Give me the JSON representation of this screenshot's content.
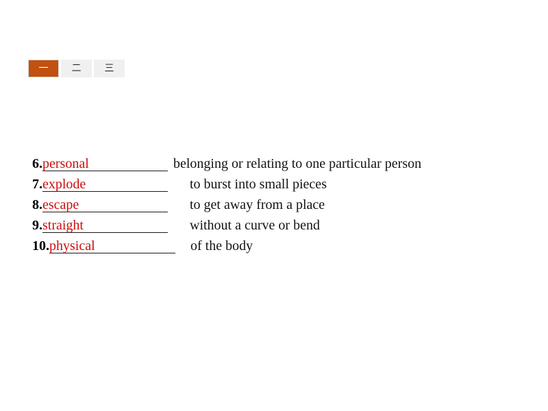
{
  "slide": {
    "background_color": "#ffffff"
  },
  "tabs": {
    "active_index": 0,
    "items": [
      {
        "label": "一",
        "icon": "chinese-numeral-one",
        "active": true
      },
      {
        "label": "二",
        "icon": "chinese-numeral-two",
        "active": false
      },
      {
        "label": "三",
        "icon": "chinese-numeral-three",
        "active": false
      }
    ],
    "active_background": "#c2500e",
    "active_text_color": "#ffffff",
    "inactive_background": "#f0f0f0",
    "inactive_text_color": "#262626"
  },
  "exercise": {
    "answer_color": "#cc0d0d",
    "number_color": "#000000",
    "definition_color": "#131313",
    "items": [
      {
        "number": "6.",
        "answer": "personal",
        "definition": "belonging or relating to one particular person"
      },
      {
        "number": "7.",
        "answer": "explode",
        "definition": "to burst into small pieces"
      },
      {
        "number": "8.",
        "answer": "escape",
        "definition": "to get away from a place"
      },
      {
        "number": "9.",
        "answer": "straight",
        "definition": "without a curve or bend"
      },
      {
        "number": "10.",
        "answer": "physical",
        "definition": "of the body"
      }
    ]
  }
}
